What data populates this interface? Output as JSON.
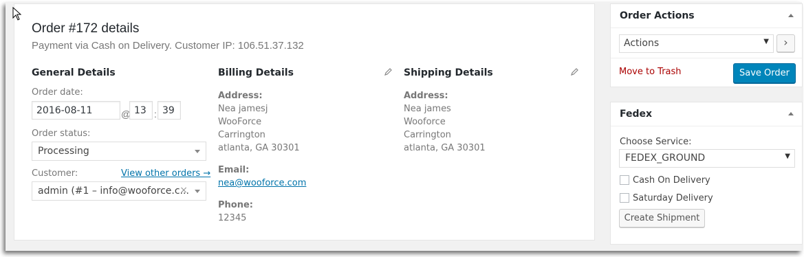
{
  "order": {
    "title": "Order #172 details",
    "subtitle": "Payment via Cash on Delivery. Customer IP: 106.51.37.132"
  },
  "general": {
    "heading": "General Details",
    "date_label": "Order date:",
    "date_value": "2016-08-11",
    "at_sep": "@",
    "hour_value": "13",
    "colon_sep": ":",
    "minute_value": "39",
    "status_label": "Order status:",
    "status_value": "Processing",
    "customer_label": "Customer:",
    "view_orders_link": "View other orders →",
    "customer_value": "admin (#1 – info@wooforce.c...",
    "clear_icon": "×"
  },
  "billing": {
    "heading": "Billing Details",
    "address_label": "Address:",
    "address_lines": [
      "Nea jamesj",
      "WooForce",
      "Carrington",
      "atlanta, GA 30301"
    ],
    "email_label": "Email:",
    "email_value": "nea@wooforce.com",
    "phone_label": "Phone:",
    "phone_value": "12345",
    "edit_icon": "pencil-icon"
  },
  "shipping": {
    "heading": "Shipping Details",
    "address_label": "Address:",
    "address_lines": [
      "Nea james",
      "Wooforce",
      "Carrington",
      "atlanta, GA 30301"
    ],
    "edit_icon": "pencil-icon"
  },
  "order_actions": {
    "title": "Order Actions",
    "select_value": "Actions",
    "go_button": "›",
    "trash_link": "Move to Trash",
    "save_button": "Save Order"
  },
  "fedex": {
    "title": "Fedex",
    "service_label": "Choose Service:",
    "service_value": "FEDEX_GROUND",
    "cod_label": "Cash On Delivery",
    "saturday_label": "Saturday Delivery",
    "create_button": "Create Shipment"
  },
  "colors": {
    "primary": "#0085ba",
    "link": "#0073aa",
    "trash": "#a00000"
  }
}
